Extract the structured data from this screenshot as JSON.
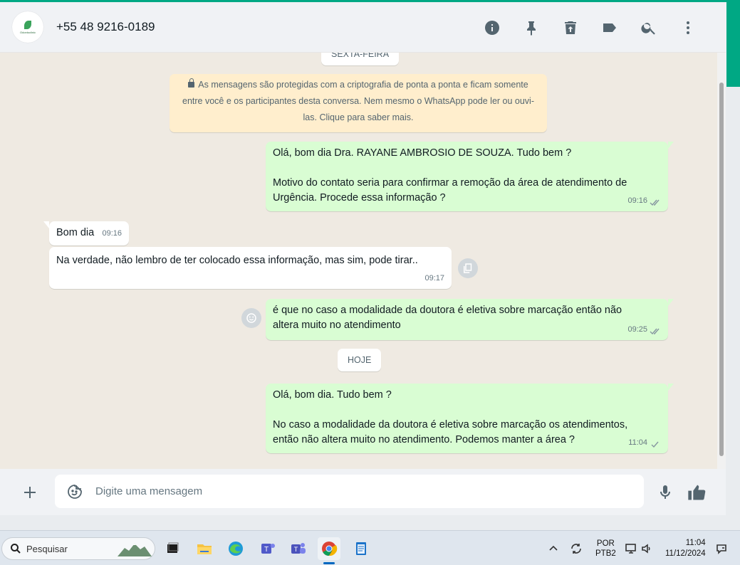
{
  "header": {
    "contact_name": "+55 48 9216-0189",
    "avatar_text": "Odontoclinic"
  },
  "chat": {
    "day_label_previous": "SEXTA-FEIRA",
    "encryption_notice": "As mensagens são protegidas com a criptografia de ponta a ponta e ficam somente entre você e os participantes desta conversa. Nem mesmo o WhatsApp pode ler ou ouvi-las. Clique para saber mais.",
    "day_label_today": "HOJE",
    "messages": [
      {
        "direction": "out",
        "lines": [
          "Olá, bom dia Dra. RAYANE AMBROSIO DE SOUZA. Tudo bem ?",
          "",
          "Motivo do contato seria para confirmar a remoção da área de atendimento de",
          "Urgência. Procede essa informação ?"
        ],
        "time": "09:16",
        "status": "read"
      },
      {
        "direction": "in",
        "lines": [
          "Bom dia"
        ],
        "time": "09:16"
      },
      {
        "direction": "in",
        "lines": [
          "Na verdade, não lembro de ter colocado essa informação, mas sim, pode tirar.."
        ],
        "time": "09:17"
      },
      {
        "direction": "out",
        "lines": [
          "é que no caso a modalidade da doutora é eletiva sobre marcação então não",
          "altera muito no atendimento"
        ],
        "time": "09:25",
        "status": "read"
      },
      {
        "direction": "out",
        "lines": [
          "Olá, bom dia. Tudo bem ?",
          "",
          "No caso a modalidade da doutora é eletiva sobre marcação os atendimentos,",
          "então não altera muito no atendimento. Podemos manter a área ?"
        ],
        "time": "11:04",
        "status": "sent"
      }
    ]
  },
  "composer": {
    "placeholder": "Digite uma mensagem"
  },
  "taskbar": {
    "search_label": "Pesquisar",
    "language_top": "POR",
    "language_bottom": "PTB2",
    "clock_time": "11:04",
    "clock_date": "11/12/2024"
  },
  "icons": {
    "header": [
      "info-icon",
      "pin-icon",
      "delete-icon",
      "label-icon",
      "search-icon",
      "menu-icon"
    ],
    "composer": [
      "plus-icon",
      "sticker-icon",
      "mic-icon",
      "thumbs-up-icon"
    ]
  },
  "colors": {
    "accent": "#00a884",
    "outgoing_bubble": "#d9fdd3",
    "incoming_bubble": "#ffffff",
    "chat_background": "#efeae2",
    "encryption_banner": "#ffeecd"
  }
}
